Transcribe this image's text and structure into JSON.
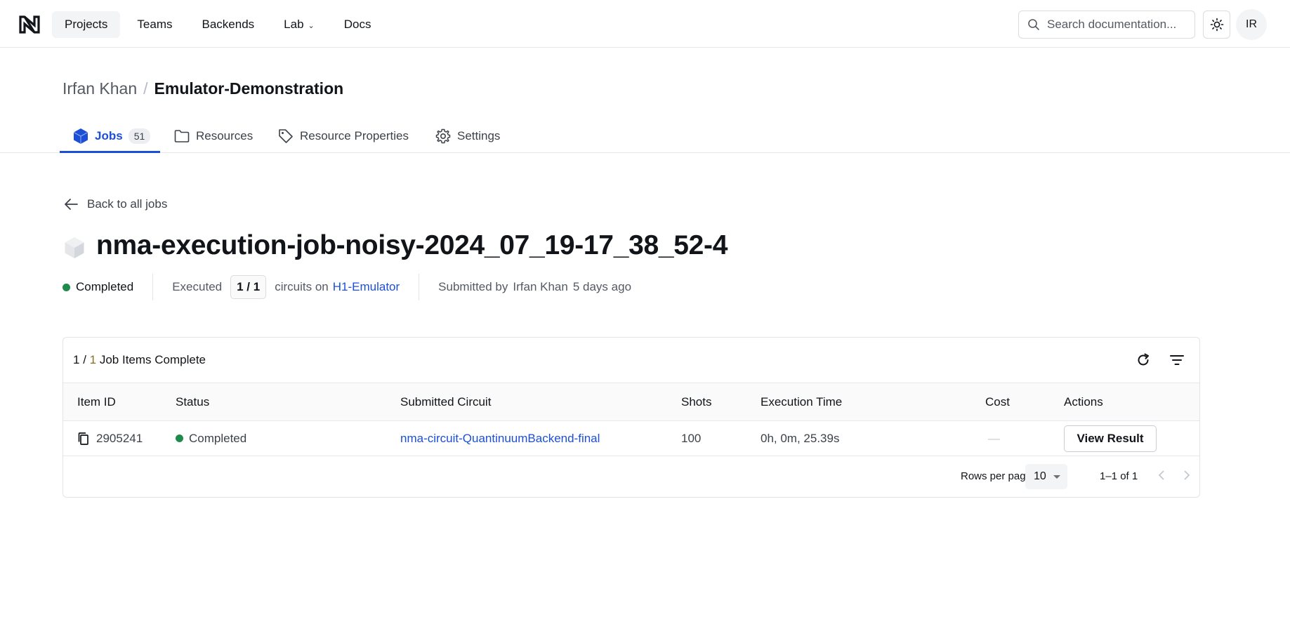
{
  "nav": {
    "items": [
      {
        "label": "Projects",
        "active": true
      },
      {
        "label": "Teams"
      },
      {
        "label": "Backends"
      },
      {
        "label": "Lab",
        "has_dropdown": true
      },
      {
        "label": "Docs"
      }
    ],
    "search_placeholder": "Search documentation...",
    "avatar_initials": "IR"
  },
  "breadcrumb": {
    "owner": "Irfan Khan",
    "separator": "/",
    "project": "Emulator-Demonstration"
  },
  "tabs": [
    {
      "label": "Jobs",
      "count": "51",
      "active": true,
      "icon": "cube-icon"
    },
    {
      "label": "Resources",
      "icon": "folder-icon"
    },
    {
      "label": "Resource Properties",
      "icon": "tag-icon"
    },
    {
      "label": "Settings",
      "icon": "gear-icon"
    }
  ],
  "back_link": "Back to all jobs",
  "job": {
    "title": "nma-execution-job-noisy-2024_07_19-17_38_52-4",
    "status": "Completed",
    "executed_label": "Executed",
    "executed_count": "1 / 1",
    "circuits_on": "circuits on",
    "backend": "H1-Emulator",
    "submitted_by_label": "Submitted by",
    "submitter": "Irfan Khan",
    "submitted_ago": "5 days ago"
  },
  "items_card": {
    "complete_done": "1",
    "complete_sep": " / ",
    "complete_total": "1",
    "complete_suffix": " Job Items Complete",
    "columns": [
      "Item ID",
      "Status",
      "Submitted Circuit",
      "Shots",
      "Execution Time",
      "Cost",
      "Actions"
    ],
    "rows": [
      {
        "item_id": "2905241",
        "status": "Completed",
        "circuit": "nma-circuit-QuantinuumBackend-final",
        "shots": "100",
        "execution_time": "0h, 0m, 25.39s",
        "cost": "—",
        "action": "View Result"
      }
    ],
    "rows_per_page_label": "Rows per page:",
    "rows_per_page": "10",
    "range": "1–1 of 1"
  },
  "colors": {
    "accent": "#1c4fd6",
    "success": "#1f8a4c",
    "text": "#111418",
    "muted": "#545a63",
    "border": "#e1e4e8"
  }
}
